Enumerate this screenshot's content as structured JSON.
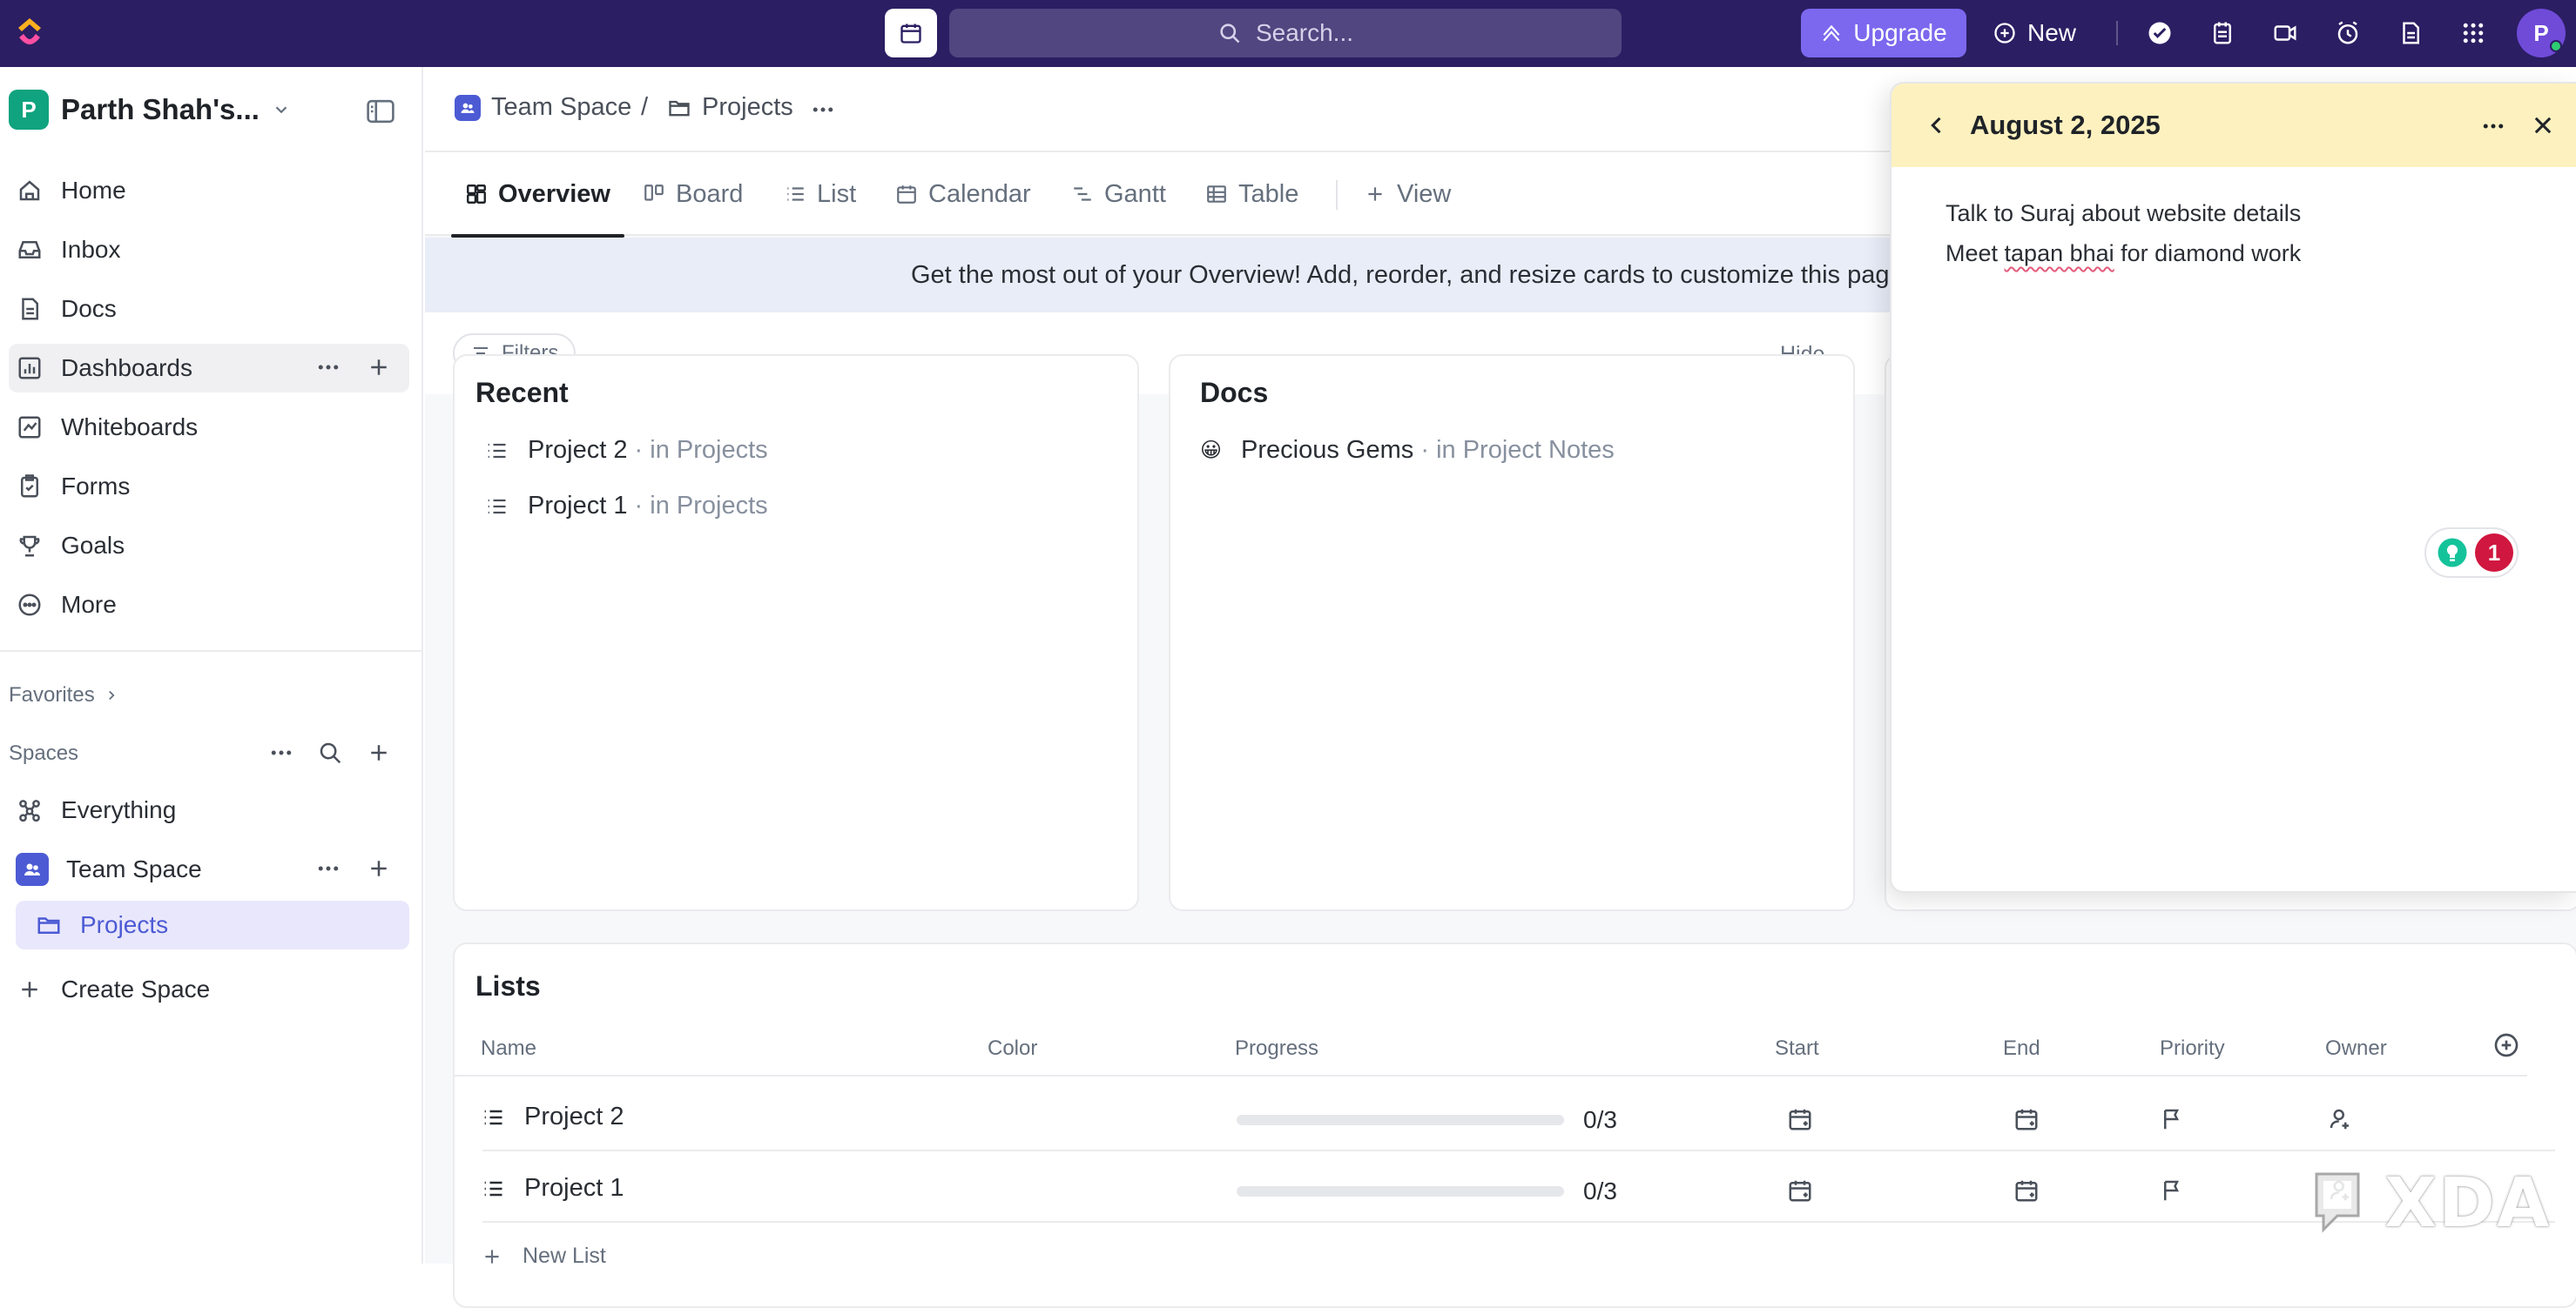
{
  "topbar": {
    "search_placeholder": "Search...",
    "upgrade_label": "Upgrade",
    "new_label": "New",
    "avatar_initial": "P",
    "brand_color": "#2b1e63",
    "accent_color": "#7b68ee"
  },
  "sidebar": {
    "workspace_initial": "P",
    "workspace_name": "Parth Shah's...",
    "nav": [
      {
        "label": "Home",
        "icon": "home-icon"
      },
      {
        "label": "Inbox",
        "icon": "inbox-icon"
      },
      {
        "label": "Docs",
        "icon": "docs-icon"
      },
      {
        "label": "Dashboards",
        "icon": "dashboard-icon"
      },
      {
        "label": "Whiteboards",
        "icon": "whiteboard-icon"
      },
      {
        "label": "Forms",
        "icon": "forms-icon"
      },
      {
        "label": "Goals",
        "icon": "trophy-icon"
      },
      {
        "label": "More",
        "icon": "more-circle-icon"
      }
    ],
    "favorites_label": "Favorites",
    "spaces_label": "Spaces",
    "everything_label": "Everything",
    "team_space_label": "Team Space",
    "projects_label": "Projects",
    "create_space_label": "Create Space"
  },
  "breadcrumb": {
    "space": "Team Space",
    "separator": "/",
    "folder": "Projects"
  },
  "tabs": [
    {
      "label": "Overview"
    },
    {
      "label": "Board"
    },
    {
      "label": "List"
    },
    {
      "label": "Calendar"
    },
    {
      "label": "Gantt"
    },
    {
      "label": "Table"
    },
    {
      "label": "View"
    }
  ],
  "banner": {
    "text": "Get the most out of your Overview! Add, reorder, and resize cards to customize this pag"
  },
  "filters": {
    "filters_label": "Filters",
    "hide_label": "Hide"
  },
  "recent": {
    "title": "Recent",
    "items": [
      {
        "name": "Project 2",
        "location": "in Projects"
      },
      {
        "name": "Project 1",
        "location": "in Projects"
      }
    ]
  },
  "docs": {
    "title": "Docs",
    "items": [
      {
        "emoji": "😀",
        "name": "Precious Gems",
        "location": "in Project Notes"
      }
    ]
  },
  "lists": {
    "title": "Lists",
    "columns": [
      "Name",
      "Color",
      "Progress",
      "Start",
      "End",
      "Priority",
      "Owner"
    ],
    "rows": [
      {
        "name": "Project 2",
        "progress_label": "0/3",
        "progress_fraction": 0
      },
      {
        "name": "Project 1",
        "progress_label": "0/3",
        "progress_fraction": 0
      }
    ],
    "new_list_label": "New List"
  },
  "note_panel": {
    "date": "August 2, 2025",
    "header_color": "#fdf1bf",
    "lines": [
      "Talk to Suraj about website details",
      {
        "pre": "Meet ",
        "flagged": "tapan bhai",
        "post": " for diamond work"
      }
    ],
    "grammarly_count": "1"
  },
  "watermark": {
    "text": "XDA"
  }
}
